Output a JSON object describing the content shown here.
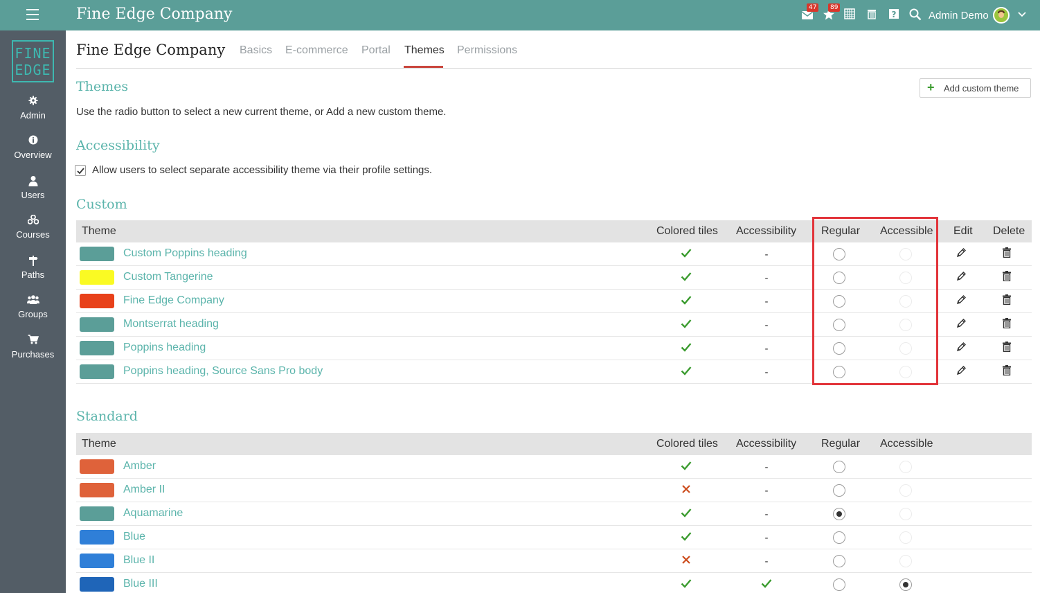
{
  "app": {
    "title": "Fine Edge Company"
  },
  "topbar": {
    "mail_badge": "47",
    "notifications_badge": "89",
    "user_name": "Admin Demo"
  },
  "sidebar": {
    "logo_line1": "FINE",
    "logo_line2": "EDGE",
    "items": [
      {
        "label": "Admin",
        "icon": "gear-icon"
      },
      {
        "label": "Overview",
        "icon": "info-icon"
      },
      {
        "label": "Users",
        "icon": "user-icon"
      },
      {
        "label": "Courses",
        "icon": "courses-icon"
      },
      {
        "label": "Paths",
        "icon": "signpost-icon"
      },
      {
        "label": "Groups",
        "icon": "group-icon"
      },
      {
        "label": "Purchases",
        "icon": "cart-icon"
      }
    ]
  },
  "page": {
    "title": "Fine Edge Company",
    "tabs": [
      "Basics",
      "E-commerce",
      "Portal",
      "Themes",
      "Permissions"
    ],
    "active_tab": "Themes"
  },
  "themes": {
    "heading": "Themes",
    "description": "Use the radio button to select a new current theme, or Add a new custom theme.",
    "add_button": "Add custom theme"
  },
  "accessibility": {
    "heading": "Accessibility",
    "checkbox_label": "Allow users to select separate accessibility theme via their profile settings.",
    "checked": true
  },
  "custom": {
    "heading": "Custom",
    "columns": [
      "Theme",
      "Colored tiles",
      "Accessibility",
      "Regular",
      "Accessible",
      "Edit",
      "Delete"
    ],
    "rows": [
      {
        "name": "Custom Poppins heading",
        "color": "#5b9e98",
        "colored_tiles": "check",
        "accessibility": "-"
      },
      {
        "name": "Custom Tangerine",
        "color": "#fafa23",
        "colored_tiles": "check",
        "accessibility": "-"
      },
      {
        "name": "Fine Edge Company",
        "color": "#e8411a",
        "colored_tiles": "check",
        "accessibility": "-"
      },
      {
        "name": "Montserrat heading",
        "color": "#5b9e98",
        "colored_tiles": "check",
        "accessibility": "-"
      },
      {
        "name": "Poppins heading",
        "color": "#5b9e98",
        "colored_tiles": "check",
        "accessibility": "-"
      },
      {
        "name": "Poppins heading, Source Sans Pro body",
        "color": "#5b9e98",
        "colored_tiles": "check",
        "accessibility": "-"
      }
    ]
  },
  "standard": {
    "heading": "Standard",
    "columns": [
      "Theme",
      "Colored tiles",
      "Accessibility",
      "Regular",
      "Accessible"
    ],
    "rows": [
      {
        "name": "Amber",
        "color": "#df623a",
        "colored_tiles": "check",
        "accessibility": "-",
        "regular_selected": false,
        "accessible_selected": false
      },
      {
        "name": "Amber II",
        "color": "#df623a",
        "colored_tiles": "cross",
        "accessibility": "-",
        "regular_selected": false,
        "accessible_selected": false
      },
      {
        "name": "Aquamarine",
        "color": "#5b9e98",
        "colored_tiles": "check",
        "accessibility": "-",
        "regular_selected": true,
        "accessible_selected": false
      },
      {
        "name": "Blue",
        "color": "#2f7fd8",
        "colored_tiles": "check",
        "accessibility": "-",
        "regular_selected": false,
        "accessible_selected": false
      },
      {
        "name": "Blue II",
        "color": "#2f7fd8",
        "colored_tiles": "cross",
        "accessibility": "-",
        "regular_selected": false,
        "accessible_selected": false
      },
      {
        "name": "Blue III",
        "color": "#1f65b8",
        "colored_tiles": "check",
        "accessibility": "check",
        "regular_selected": false,
        "accessible_selected": true
      }
    ]
  },
  "colors": {
    "accent": "#5bb4ab",
    "topbar": "#5b9e98",
    "sidebar": "#535d66",
    "check": "#3a9b2e",
    "cross": "#cc4b1c",
    "highlight": "#e2343a"
  }
}
